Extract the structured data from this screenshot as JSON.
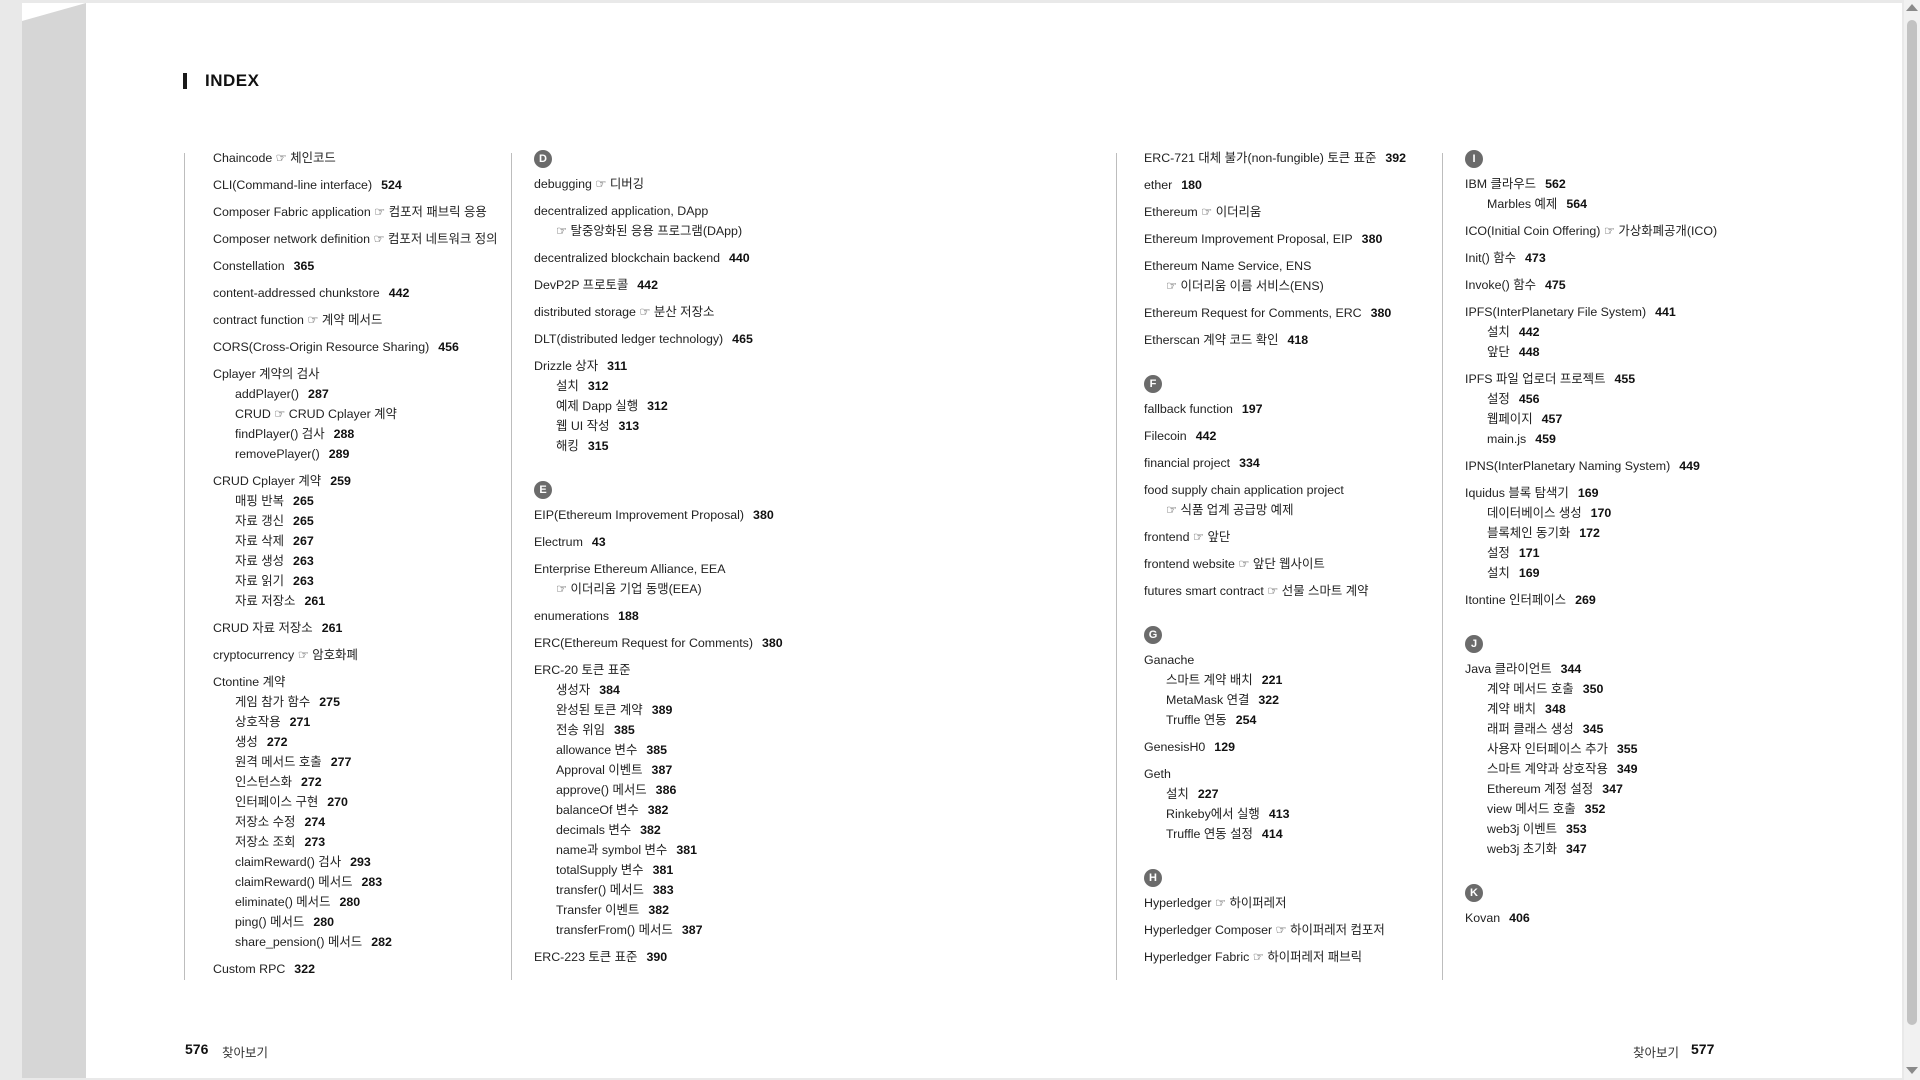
{
  "page": {
    "title": "INDEX",
    "left_footer": {
      "number": "576",
      "label": "찾아보기"
    },
    "right_footer": {
      "number": "577",
      "label": "찾아보기"
    }
  },
  "columns": [
    {
      "items": [
        {
          "type": "entry",
          "text": "Chaincode ☞ 체인코드"
        },
        {
          "type": "entry",
          "text": "CLI(Command-line interface)",
          "page": "524"
        },
        {
          "type": "entry",
          "text": "Composer Fabric application ☞ 컴포저 패브릭 응용"
        },
        {
          "type": "entry",
          "text": "Composer network definition ☞ 컴포저 네트워크 정의"
        },
        {
          "type": "entry",
          "text": "Constellation",
          "page": "365"
        },
        {
          "type": "entry",
          "text": "content-addressed chunkstore",
          "page": "442"
        },
        {
          "type": "entry",
          "text": "contract function ☞ 계약 메서드"
        },
        {
          "type": "entry",
          "text": "CORS(Cross-Origin Resource Sharing)",
          "page": "456"
        },
        {
          "type": "entry",
          "text": "Cplayer 계약의 검사",
          "subs": [
            {
              "text": "addPlayer()",
              "page": "287"
            },
            {
              "text": "CRUD ☞ CRUD Cplayer 계약"
            },
            {
              "text": "findPlayer() 검사",
              "page": "288"
            },
            {
              "text": "removePlayer()",
              "page": "289"
            }
          ]
        },
        {
          "type": "entry",
          "text": "CRUD Cplayer 계약",
          "page": "259",
          "subs": [
            {
              "text": "매핑 반복",
              "page": "265"
            },
            {
              "text": "자료 갱신",
              "page": "265"
            },
            {
              "text": "자료 삭제",
              "page": "267"
            },
            {
              "text": "자료 생성",
              "page": "263"
            },
            {
              "text": "자료 읽기",
              "page": "263"
            },
            {
              "text": "자료 저장소",
              "page": "261"
            }
          ]
        },
        {
          "type": "entry",
          "text": "CRUD 자료 저장소",
          "page": "261"
        },
        {
          "type": "entry",
          "text": "cryptocurrency ☞ 암호화폐"
        },
        {
          "type": "entry",
          "text": "Ctontine 계약",
          "subs": [
            {
              "text": "게임 참가 함수",
              "page": "275"
            },
            {
              "text": "상호작용",
              "page": "271"
            },
            {
              "text": "생성",
              "page": "272"
            },
            {
              "text": "원격 메서드 호출",
              "page": "277"
            },
            {
              "text": "인스턴스화",
              "page": "272"
            },
            {
              "text": "인터페이스 구현",
              "page": "270"
            },
            {
              "text": "저장소 수정",
              "page": "274"
            },
            {
              "text": "저장소 조회",
              "page": "273"
            },
            {
              "text": "claimReward() 검사",
              "page": "293"
            },
            {
              "text": "claimReward() 메서드",
              "page": "283"
            },
            {
              "text": "eliminate() 메서드",
              "page": "280"
            },
            {
              "text": "ping() 메서드",
              "page": "280"
            },
            {
              "text": "share_pension() 메서드",
              "page": "282"
            }
          ]
        },
        {
          "type": "entry",
          "text": "Custom RPC",
          "page": "322"
        }
      ]
    },
    {
      "items": [
        {
          "type": "letter",
          "text": "D"
        },
        {
          "type": "entry",
          "text": "debugging ☞ 디버깅"
        },
        {
          "type": "entry",
          "text": "decentralized application, DApp",
          "ref": "☞ 탈중앙화된 응용 프로그램(DApp)"
        },
        {
          "type": "entry",
          "text": "decentralized blockchain backend",
          "page": "440"
        },
        {
          "type": "entry",
          "text": "DevP2P 프로토콜",
          "page": "442"
        },
        {
          "type": "entry",
          "text": "distributed storage ☞ 분산 저장소"
        },
        {
          "type": "entry",
          "text": "DLT(distributed ledger technology)",
          "page": "465"
        },
        {
          "type": "entry",
          "text": "Drizzle 상자",
          "page": "311",
          "subs": [
            {
              "text": "설치",
              "page": "312"
            },
            {
              "text": "예제 Dapp 실행",
              "page": "312"
            },
            {
              "text": "웹 UI 작성",
              "page": "313"
            },
            {
              "text": "해킹",
              "page": "315"
            }
          ]
        },
        {
          "type": "gap"
        },
        {
          "type": "letter",
          "text": "E"
        },
        {
          "type": "entry",
          "text": "EIP(Ethereum Improvement Proposal)",
          "page": "380"
        },
        {
          "type": "entry",
          "text": "Electrum",
          "page": "43"
        },
        {
          "type": "entry",
          "text": "Enterprise Ethereum Alliance, EEA",
          "ref": "☞ 이더리움 기업 동맹(EEA)"
        },
        {
          "type": "entry",
          "text": "enumerations",
          "page": "188"
        },
        {
          "type": "entry",
          "text": "ERC(Ethereum Request for Comments)",
          "page": "380"
        },
        {
          "type": "entry",
          "text": "ERC-20 토큰 표준",
          "subs": [
            {
              "text": "생성자",
              "page": "384"
            },
            {
              "text": "완성된 토큰 계약",
              "page": "389"
            },
            {
              "text": "전송 위임",
              "page": "385"
            },
            {
              "text": "allowance 변수",
              "page": "385"
            },
            {
              "text": "Approval 이벤트",
              "page": "387"
            },
            {
              "text": "approve() 메서드",
              "page": "386"
            },
            {
              "text": "balanceOf 변수",
              "page": "382"
            },
            {
              "text": "decimals 변수",
              "page": "382"
            },
            {
              "text": "name과 symbol 변수",
              "page": "381"
            },
            {
              "text": "totalSupply 변수",
              "page": "381"
            },
            {
              "text": "transfer() 메서드",
              "page": "383"
            },
            {
              "text": "Transfer 이벤트",
              "page": "382"
            },
            {
              "text": "transferFrom() 메서드",
              "page": "387"
            }
          ]
        },
        {
          "type": "entry",
          "text": "ERC-223 토큰 표준",
          "page": "390"
        }
      ]
    },
    {
      "items": [
        {
          "type": "entry",
          "text": "ERC-721 대체 불가(non-fungible) 토큰 표준",
          "page": "392"
        },
        {
          "type": "entry",
          "text": "ether",
          "page": "180"
        },
        {
          "type": "entry",
          "text": "Ethereum ☞ 이더리움"
        },
        {
          "type": "entry",
          "text": "Ethereum Improvement Proposal, EIP",
          "page": "380"
        },
        {
          "type": "entry",
          "text": "Ethereum Name Service, ENS",
          "ref": "☞ 이더리움 이름 서비스(ENS)"
        },
        {
          "type": "entry",
          "text": "Ethereum Request for Comments, ERC",
          "page": "380"
        },
        {
          "type": "entry",
          "text": "Etherscan 계약 코드 확인",
          "page": "418"
        },
        {
          "type": "gap"
        },
        {
          "type": "letter",
          "text": "F"
        },
        {
          "type": "entry",
          "text": "fallback function",
          "page": "197"
        },
        {
          "type": "entry",
          "text": "Filecoin",
          "page": "442"
        },
        {
          "type": "entry",
          "text": "financial project",
          "page": "334"
        },
        {
          "type": "entry",
          "text": "food supply chain application project",
          "ref": "☞ 식품 업계 공급망 예제"
        },
        {
          "type": "entry",
          "text": "frontend ☞ 앞단"
        },
        {
          "type": "entry",
          "text": "frontend website ☞ 앞단 웹사이트"
        },
        {
          "type": "entry",
          "text": "futures smart contract ☞ 선물 스마트 계약"
        },
        {
          "type": "gap"
        },
        {
          "type": "letter",
          "text": "G"
        },
        {
          "type": "entry",
          "text": "Ganache",
          "subs": [
            {
              "text": "스마트 계약 배치",
              "page": "221"
            },
            {
              "text": "MetaMask 연결",
              "page": "322"
            },
            {
              "text": "Truffle 연동",
              "page": "254"
            }
          ]
        },
        {
          "type": "entry",
          "text": "GenesisH0",
          "page": "129"
        },
        {
          "type": "entry",
          "text": "Geth",
          "subs": [
            {
              "text": "설치",
              "page": "227"
            },
            {
              "text": "Rinkeby에서 실행",
              "page": "413"
            },
            {
              "text": "Truffle 연동 설정",
              "page": "414"
            }
          ]
        },
        {
          "type": "gap"
        },
        {
          "type": "letter",
          "text": "H"
        },
        {
          "type": "entry",
          "text": "Hyperledger ☞ 하이퍼레저"
        },
        {
          "type": "entry",
          "text": "Hyperledger Composer ☞ 하이퍼레저 컴포저"
        },
        {
          "type": "entry",
          "text": "Hyperledger Fabric ☞ 하이퍼레저 패브릭"
        }
      ]
    },
    {
      "items": [
        {
          "type": "letter",
          "text": "I"
        },
        {
          "type": "entry",
          "text": "IBM 클라우드",
          "page": "562",
          "subs": [
            {
              "text": "Marbles 예제",
              "page": "564"
            }
          ]
        },
        {
          "type": "entry",
          "text": "ICO(Initial Coin Offering) ☞ 가상화폐공개(ICO)"
        },
        {
          "type": "entry",
          "text": "Init() 함수",
          "page": "473"
        },
        {
          "type": "entry",
          "text": "Invoke() 함수",
          "page": "475"
        },
        {
          "type": "entry",
          "text": "IPFS(InterPlanetary File System)",
          "page": "441",
          "subs": [
            {
              "text": "설치",
              "page": "442"
            },
            {
              "text": "앞단",
              "page": "448"
            }
          ]
        },
        {
          "type": "entry",
          "text": "IPFS 파일 업로더 프로젝트",
          "page": "455",
          "subs": [
            {
              "text": "설정",
              "page": "456"
            },
            {
              "text": "웹페이지",
              "page": "457"
            },
            {
              "text": "main.js",
              "page": "459"
            }
          ]
        },
        {
          "type": "entry",
          "text": "IPNS(InterPlanetary Naming System)",
          "page": "449"
        },
        {
          "type": "entry",
          "text": "Iquidus 블록 탐색기",
          "page": "169",
          "subs": [
            {
              "text": "데이터베이스 생성",
              "page": "170"
            },
            {
              "text": "블록체인 동기화",
              "page": "172"
            },
            {
              "text": "설정",
              "page": "171"
            },
            {
              "text": "설치",
              "page": "169"
            }
          ]
        },
        {
          "type": "entry",
          "text": "Itontine 인터페이스",
          "page": "269"
        },
        {
          "type": "gap"
        },
        {
          "type": "letter",
          "text": "J"
        },
        {
          "type": "entry",
          "text": "Java 클라이언트",
          "page": "344",
          "subs": [
            {
              "text": "계약 메서드 호출",
              "page": "350"
            },
            {
              "text": "계약 배치",
              "page": "348"
            },
            {
              "text": "래퍼 클래스 생성",
              "page": "345"
            },
            {
              "text": "사용자 인터페이스 추가",
              "page": "355"
            },
            {
              "text": "스마트 계약과 상호작용",
              "page": "349"
            },
            {
              "text": "Ethereum 계정 설정",
              "page": "347"
            },
            {
              "text": "view 메서드 호출",
              "page": "352"
            },
            {
              "text": "web3j 이벤트",
              "page": "353"
            },
            {
              "text": "web3j 초기화",
              "page": "347"
            }
          ]
        },
        {
          "type": "gap"
        },
        {
          "type": "letter",
          "text": "K"
        },
        {
          "type": "entry",
          "text": "Kovan",
          "page": "406"
        }
      ]
    }
  ]
}
